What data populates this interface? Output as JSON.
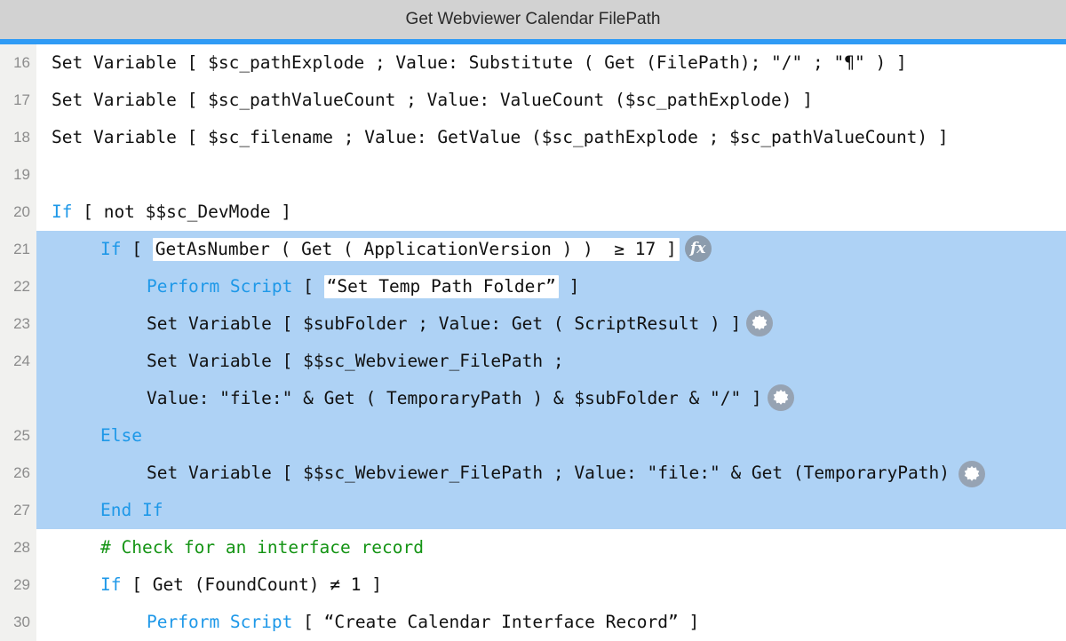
{
  "window": {
    "title": "Get Webviewer Calendar FilePath",
    "accent_color": "#2f9bf5",
    "titlebar_color": "#d2d2d2"
  },
  "editor": {
    "gutter_color": "#f1f1ef",
    "selection_color": "#aed2f5",
    "keyword_color": "#1e98e8",
    "comment_color": "#149414",
    "text_color": "#111111",
    "icon_fx_color": "#8c9cad",
    "icon_gear_color": "#96a3b3"
  },
  "icons": {
    "fx": "fx-icon",
    "gear": "gear-icon"
  },
  "script_lines": [
    {
      "number": "16",
      "selected": false,
      "indent": 0,
      "segments": [
        {
          "text": "Set Variable [ $sc_pathExplode ; Value: Substitute ( Get (FilePath); \"/\" ; \"¶\" ) ]",
          "style": "plain"
        }
      ]
    },
    {
      "number": "17",
      "selected": false,
      "indent": 0,
      "segments": [
        {
          "text": "Set Variable [ $sc_pathValueCount ; Value: ValueCount ($sc_pathExplode) ]",
          "style": "plain"
        }
      ]
    },
    {
      "number": "18",
      "selected": false,
      "indent": 0,
      "segments": [
        {
          "text": "Set Variable [ $sc_filename ; Value: GetValue ($sc_pathExplode ; $sc_pathValueCount) ]",
          "style": "plain"
        }
      ]
    },
    {
      "number": "19",
      "selected": false,
      "indent": 0,
      "segments": []
    },
    {
      "number": "20",
      "selected": false,
      "indent": 0,
      "segments": [
        {
          "text": "If",
          "style": "keyword"
        },
        {
          "text": " [ not $$sc_DevMode ]",
          "style": "plain"
        }
      ]
    },
    {
      "number": "21",
      "selected": true,
      "indent": 2,
      "segments": [
        {
          "text": "If",
          "style": "keyword"
        },
        {
          "text": " [ ",
          "style": "plain"
        },
        {
          "text": "GetAsNumber ( Get ( ApplicationVersion ) )  ≥ 17 ]",
          "style": "boxed"
        }
      ],
      "icon": "fx"
    },
    {
      "number": "22",
      "selected": true,
      "indent": 3,
      "segments": [
        {
          "text": "Perform Script",
          "style": "keyword"
        },
        {
          "text": " [ ",
          "style": "plain"
        },
        {
          "text": "“Set Temp Path Folder”",
          "style": "boxed"
        },
        {
          "text": " ]",
          "style": "plain"
        }
      ]
    },
    {
      "number": "23",
      "selected": true,
      "indent": 3,
      "segments": [
        {
          "text": "Set Variable [ $subFolder ; Value: Get ( ScriptResult ) ]",
          "style": "plain"
        }
      ],
      "icon": "gear"
    },
    {
      "number": "24",
      "selected": true,
      "indent": 3,
      "segments": [
        {
          "text": "Set Variable [ $$sc_Webviewer_FilePath ;",
          "style": "plain"
        }
      ],
      "second_line": {
        "indent": 3,
        "segments": [
          {
            "text": "Value: \"file:\" & Get ( TemporaryPath ) & $subFolder & \"/\" ]",
            "style": "plain"
          }
        ],
        "icon": "gear"
      }
    },
    {
      "number": "25",
      "selected": true,
      "indent": 2,
      "segments": [
        {
          "text": "Else",
          "style": "keyword"
        }
      ]
    },
    {
      "number": "26",
      "selected": true,
      "indent": 3,
      "segments": [
        {
          "text": "Set Variable [ $$sc_Webviewer_FilePath ; Value: \"file:\" & Get (TemporaryPath) ]",
          "style": "plain"
        }
      ],
      "icon": "gear-clipped"
    },
    {
      "number": "27",
      "selected": true,
      "indent": 2,
      "segments": [
        {
          "text": "End If",
          "style": "keyword"
        }
      ]
    },
    {
      "number": "28",
      "selected": false,
      "indent": 2,
      "segments": [
        {
          "text": "# Check for an interface record",
          "style": "comment"
        }
      ]
    },
    {
      "number": "29",
      "selected": false,
      "indent": 2,
      "segments": [
        {
          "text": "If",
          "style": "keyword"
        },
        {
          "text": " [ Get (FoundCount) ≠ 1 ]",
          "style": "plain"
        }
      ]
    },
    {
      "number": "30",
      "selected": false,
      "indent": 3,
      "segments": [
        {
          "text": "Perform Script",
          "style": "keyword"
        },
        {
          "text": " [ “Create Calendar Interface Record” ]",
          "style": "plain"
        }
      ]
    }
  ]
}
